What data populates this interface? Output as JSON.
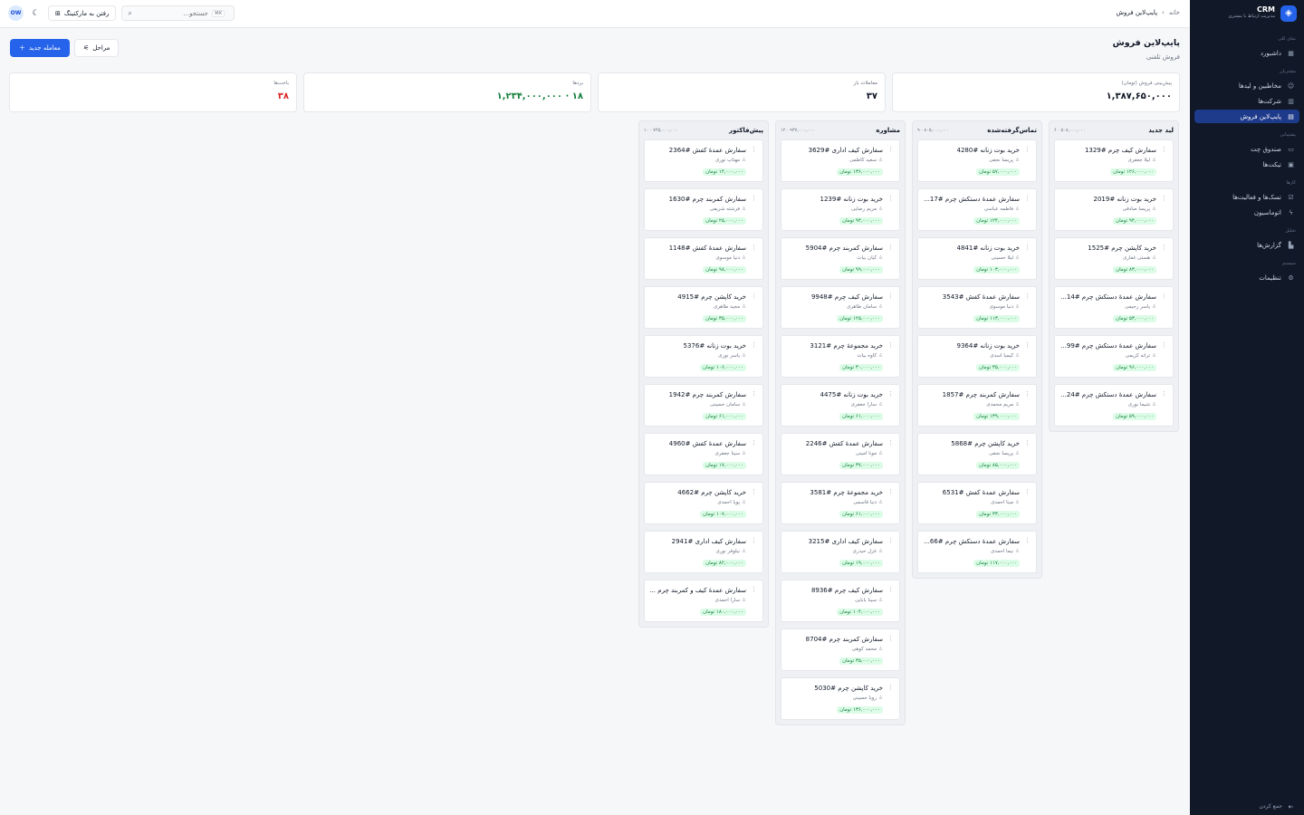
{
  "sidebar": {
    "brand_name": "CRM",
    "brand_sub": "مدیریت ارتباط با مشتری",
    "groups": [
      {
        "label": "نمای کلی",
        "items": [
          {
            "label": "داشبورد",
            "icon": "grid-icon"
          }
        ]
      },
      {
        "label": "مشتریان",
        "items": [
          {
            "label": "مخاطبین و لیدها",
            "icon": "users-icon"
          },
          {
            "label": "شرکت‌ها",
            "icon": "building-icon"
          },
          {
            "label": "پایپ‌لاین فروش",
            "icon": "kanban-icon",
            "active": true
          }
        ]
      },
      {
        "label": "پشتیبانی",
        "items": [
          {
            "label": "صندوق چت",
            "icon": "chat-icon"
          },
          {
            "label": "تیکت‌ها",
            "icon": "ticket-icon"
          }
        ]
      },
      {
        "label": "کارها",
        "items": [
          {
            "label": "تسک‌ها و فعالیت‌ها",
            "icon": "check-icon"
          },
          {
            "label": "اتوماسیون",
            "icon": "bolt-icon"
          }
        ]
      },
      {
        "label": "تحلیل",
        "items": [
          {
            "label": "گزارش‌ها",
            "icon": "chart-icon"
          }
        ]
      },
      {
        "label": "سیستم",
        "items": [
          {
            "label": "تنظیمات",
            "icon": "gear-icon"
          }
        ]
      }
    ],
    "collapse_label": "جمع کردن"
  },
  "topbar": {
    "breadcrumb": {
      "home": "خانه",
      "current": "پایپ‌لاین فروش"
    },
    "search_placeholder": "جستجو...",
    "search_kbd": "⌘K",
    "marketing_label": "رفتن به مارکتینگ",
    "avatar_initials": "OW"
  },
  "page": {
    "title": "پایپ‌لاین فروش",
    "subtitle": "فروش تلفنی",
    "new_deal_label": "معامله جدید",
    "stages_label": "مراحل"
  },
  "stats": [
    {
      "label": "پیش‌بینی فروش (تومان)",
      "value": "۱,۳۸۷,۶۵۰,۰۰۰",
      "tone": "default"
    },
    {
      "label": "معاملات باز",
      "value": "۳۷",
      "tone": "default"
    },
    {
      "label": "بردها",
      "value": "۱۸ · ۱,۲۳۴,۰۰۰,۰۰۰",
      "tone": "green"
    },
    {
      "label": "باخت‌ها",
      "value": "۳۸",
      "tone": "red"
    }
  ],
  "columns": [
    {
      "title": "لید جدید",
      "meta": "۶ · ۵۰۸,۰۰۰,۰۰۰",
      "cards": [
        {
          "title": "سفارش کیف چرم #1329",
          "person": "لیلا جعفری",
          "amount": "۱۲۶,۰۰۰,۰۰۰ تومان"
        },
        {
          "title": "خرید بوت زنانه #2019",
          "person": "پریسا صادقی",
          "amount": "۹۴,۰۰۰,۰۰۰ تومان"
        },
        {
          "title": "خرید کاپشن چرم #1525",
          "person": "هستی غفاری",
          "amount": "۸۳,۰۰۰,۰۰۰ تومان"
        },
        {
          "title": "سفارش عمدهٔ دستکش چرم #14...",
          "person": "یاسر رحیمی",
          "amount": "۵۳,۰۰۰,۰۰۰ تومان"
        },
        {
          "title": "سفارش عمدهٔ دستکش چرم #99...",
          "person": "ترانه کریمی",
          "amount": "۹۶,۰۰۰,۰۰۰ تومان"
        },
        {
          "title": "سفارش عمدهٔ دستکش چرم #24...",
          "person": "شیما نوری",
          "amount": "۵۹,۰۰۰,۰۰۰ تومان"
        }
      ]
    },
    {
      "title": "تماس‌گرفته‌شده",
      "meta": "۹ · ۸۰۵,۰۰۰,۰۰۰",
      "cards": [
        {
          "title": "خرید بوت زنانه #4280",
          "person": "پریسا نجفی",
          "amount": "۵۷,۰۰۰,۰۰۰ تومان"
        },
        {
          "title": "سفارش عمدهٔ دستکش چرم #17...",
          "person": "فاطمه عباسی",
          "amount": "۱۲۴,۰۰۰,۰۰۰ تومان"
        },
        {
          "title": "خرید بوت زنانه #4841",
          "person": "لیلا حسینی",
          "amount": "۱۰۳,۰۰۰,۰۰۰ تومان"
        },
        {
          "title": "سفارش عمدهٔ کفش #3543",
          "person": "دنیا موسوی",
          "amount": "۱۱۳,۰۰۰,۰۰۰ تومان"
        },
        {
          "title": "خرید بوت زنانه #9364",
          "person": "کیمیا اسدی",
          "amount": "۳۵,۰۰۰,۰۰۰ تومان"
        },
        {
          "title": "سفارش کمربند چرم #1857",
          "person": "مریم محمدی",
          "amount": "۱۳۹,۰۰۰,۰۰۰ تومان"
        },
        {
          "title": "خرید کاپشن چرم #5868",
          "person": "پریسا نجفی",
          "amount": "۸۵,۰۰۰,۰۰۰ تومان"
        },
        {
          "title": "سفارش عمدهٔ کفش #6531",
          "person": "مینا احمدی",
          "amount": "۳۳,۰۰۰,۰۰۰ تومان"
        },
        {
          "title": "سفارش عمدهٔ دستکش چرم #66...",
          "person": "نیما احمدی",
          "amount": "۱۱۷,۰۰۰,۰۰۰ تومان"
        }
      ]
    },
    {
      "title": "مشاوره",
      "meta": "۱۲ · ۹۳۷,۰۰۰,۰۰۰",
      "cards": [
        {
          "title": "سفارش کیف اداری #3629",
          "person": "سعید کاظمی",
          "amount": "۱۳۶,۰۰۰,۰۰۰ تومان"
        },
        {
          "title": "خرید بوت زنانه #1239",
          "person": "مریم رضایی",
          "amount": "۹۴,۰۰۰,۰۰۰ تومان"
        },
        {
          "title": "سفارش کمربند چرم #5904",
          "person": "کیان بیات",
          "amount": "۹۹,۰۰۰,۰۰۰ تومان"
        },
        {
          "title": "سفارش کیف چرم #9948",
          "person": "سامان طاهری",
          "amount": "۱۲۵,۰۰۰,۰۰۰ تومان"
        },
        {
          "title": "خرید مجموعهٔ چرم #3121",
          "person": "کاوه بیات",
          "amount": "۳۰,۰۰۰,۰۰۰ تومان"
        },
        {
          "title": "خرید بوت زنانه #4475",
          "person": "سارا جعفری",
          "amount": "۶۱,۰۰۰,۰۰۰ تومان"
        },
        {
          "title": "سفارش عمدهٔ کفش #2246",
          "person": "مونا امینی",
          "amount": "۳۷,۰۰۰,۰۰۰ تومان"
        },
        {
          "title": "خرید مجموعهٔ چرم #3581",
          "person": "دنیا قاسمی",
          "amount": "۶۱,۰۰۰,۰۰۰ تومان"
        },
        {
          "title": "سفارش کیف اداری #3215",
          "person": "غزل حیدری",
          "amount": "۱۹,۰۰۰,۰۰۰ تومان"
        },
        {
          "title": "سفارش کیف چرم #8936",
          "person": "سینا بابایی",
          "amount": "۱۰۴,۰۰۰,۰۰۰ تومان"
        },
        {
          "title": "سفارش کمربند چرم #8704",
          "person": "محمد کوهی",
          "amount": "۳۵,۰۰۰,۰۰۰ تومان"
        },
        {
          "title": "خرید کاپشن چرم #5030",
          "person": "رویا حسینی",
          "amount": "۱۳۶,۰۰۰,۰۰۰ تومان"
        }
      ]
    },
    {
      "title": "پیش‌فاکتور",
      "meta": "۱۰ · ۷۲۵,۰۰۰,۰۰۰",
      "cards": [
        {
          "title": "سفارش عمدهٔ کفش #2364",
          "person": "مهتاب نوری",
          "amount": "۱۴,۰۰۰,۰۰۰ تومان"
        },
        {
          "title": "سفارش کمربند چرم #1630",
          "person": "فرشته شریفی",
          "amount": "۲۵,۰۰۰,۰۰۰ تومان"
        },
        {
          "title": "سفارش عمدهٔ کفش #1148",
          "person": "دنیا موسوی",
          "amount": "۹۸,۰۰۰,۰۰۰ تومان"
        },
        {
          "title": "خرید کاپشن چرم #4915",
          "person": "مجید طاهری",
          "amount": "۳۵,۰۰۰,۰۰۰ تومان"
        },
        {
          "title": "خرید بوت زنانه #5376",
          "person": "یاسر نوری",
          "amount": "۱۰۶,۰۰۰,۰۰۰ تومان"
        },
        {
          "title": "سفارش کمربند چرم #1942",
          "person": "سامان حسینی",
          "amount": "۶۱,۰۰۰,۰۰۰ تومان"
        },
        {
          "title": "سفارش عمدهٔ کفش #4960",
          "person": "سینا جعفری",
          "amount": "۱۷,۰۰۰,۰۰۰ تومان"
        },
        {
          "title": "خرید کاپشن چرم #4662",
          "person": "پویا احمدی",
          "amount": "۱۰۷,۰۰۰,۰۰۰ تومان"
        },
        {
          "title": "سفارش کیف اداری #2941",
          "person": "نیلوفر نوری",
          "amount": "۸۲,۰۰۰,۰۰۰ تومان"
        },
        {
          "title": "سفارش عمدهٔ کیف و کمربند چرم ...",
          "person": "سارا احمدی",
          "amount": "۱۸۰,۰۰۰,۰۰۰ تومان"
        }
      ]
    }
  ]
}
